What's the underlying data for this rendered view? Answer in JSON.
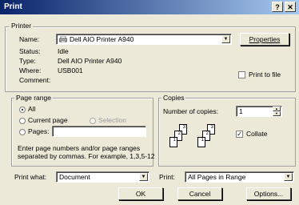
{
  "window": {
    "title": "Print",
    "help_label": "?",
    "close_label": "✕"
  },
  "printer": {
    "group_label": "Printer",
    "name_label": "Name:",
    "name_value": "Dell AIO Printer A940",
    "properties_button": "Properties",
    "status_label": "Status:",
    "status_value": "Idle",
    "type_label": "Type:",
    "type_value": "Dell AIO Printer A940",
    "where_label": "Where:",
    "where_value": "USB001",
    "comment_label": "Comment:",
    "print_to_file_label": "Print to file",
    "print_to_file_checked": false
  },
  "page_range": {
    "group_label": "Page range",
    "all_label": "All",
    "current_page_label": "Current page",
    "selection_label": "Selection",
    "pages_label": "Pages:",
    "pages_value": "",
    "selected": "all",
    "hint_line1": "Enter page numbers and/or page ranges",
    "hint_line2": "separated by commas.  For example, 1,3,5-12"
  },
  "copies": {
    "group_label": "Copies",
    "number_label": "Number of copies:",
    "number_value": "1",
    "collate_label": "Collate",
    "collate_checked": true,
    "stack_a": [
      "1",
      "2",
      "3"
    ],
    "stack_b": [
      "1",
      "2",
      "3"
    ]
  },
  "bottom": {
    "print_what_label": "Print what:",
    "print_what_value": "Document",
    "print_label": "Print:",
    "print_value": "All Pages in Range",
    "ok_button": "OK",
    "cancel_button": "Cancel",
    "options_button": "Options..."
  }
}
